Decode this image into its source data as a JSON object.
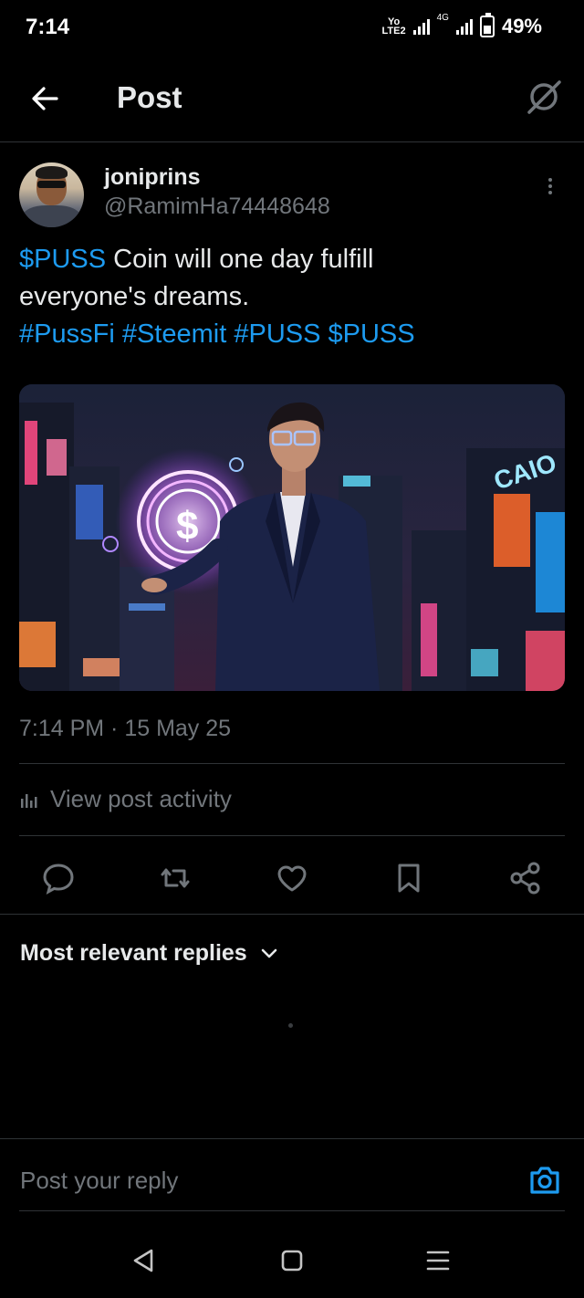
{
  "status_bar": {
    "time": "7:14",
    "network_badge": "Yo LTE2",
    "net_gen": "4G",
    "battery": "49%"
  },
  "header": {
    "title": "Post",
    "back_icon": "arrow-left-icon",
    "grok_icon": "grok-icon"
  },
  "author": {
    "display_name": "joniprins",
    "handle": "@RamimHa74448648"
  },
  "post": {
    "cashtag_lead": "$PUSS",
    "text_line1_rest": " Coin will one day fulfill",
    "text_line2": "everyone's dreams.",
    "hashtags": [
      "#PussFi",
      "#Steemit",
      "#PUSS",
      "$PUSS"
    ],
    "timestamp": "7:14 PM · 15 May 25"
  },
  "media_text": {
    "sign1": "CAIO",
    "coin_symbol": "$"
  },
  "activity_label": "View post activity",
  "actions": [
    "reply-icon",
    "repost-icon",
    "like-icon",
    "bookmark-icon",
    "share-icon"
  ],
  "replies": {
    "sort_label": "Most relevant replies"
  },
  "reply_box": {
    "placeholder": "Post your reply"
  },
  "colors": {
    "accent": "#1d9bf0",
    "muted": "#71767b",
    "text": "#e7e9ea",
    "divider": "#2f3336"
  }
}
